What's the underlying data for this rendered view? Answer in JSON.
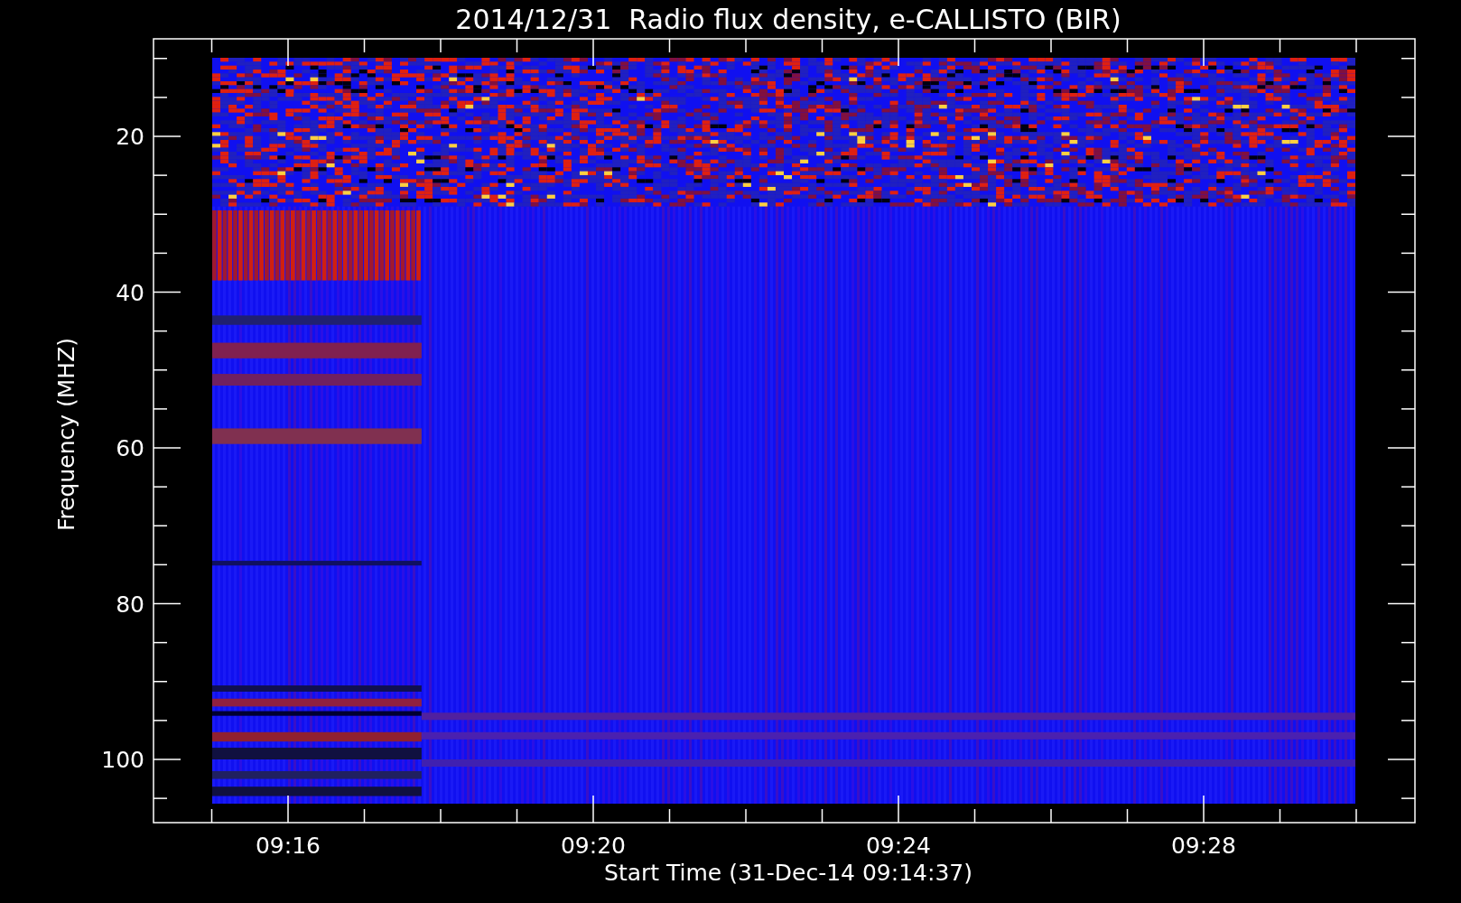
{
  "title": "2014/12/31  Radio flux density, e-CALLISTO (BIR)",
  "ylabel": "Frequency (MHZ)",
  "xlabel": "Start Time (31-Dec-14 09:14:37)",
  "yticks": [
    "20",
    "40",
    "60",
    "80",
    "100"
  ],
  "xticks": [
    "09:16",
    "09:20",
    "09:24",
    "09:28"
  ]
}
